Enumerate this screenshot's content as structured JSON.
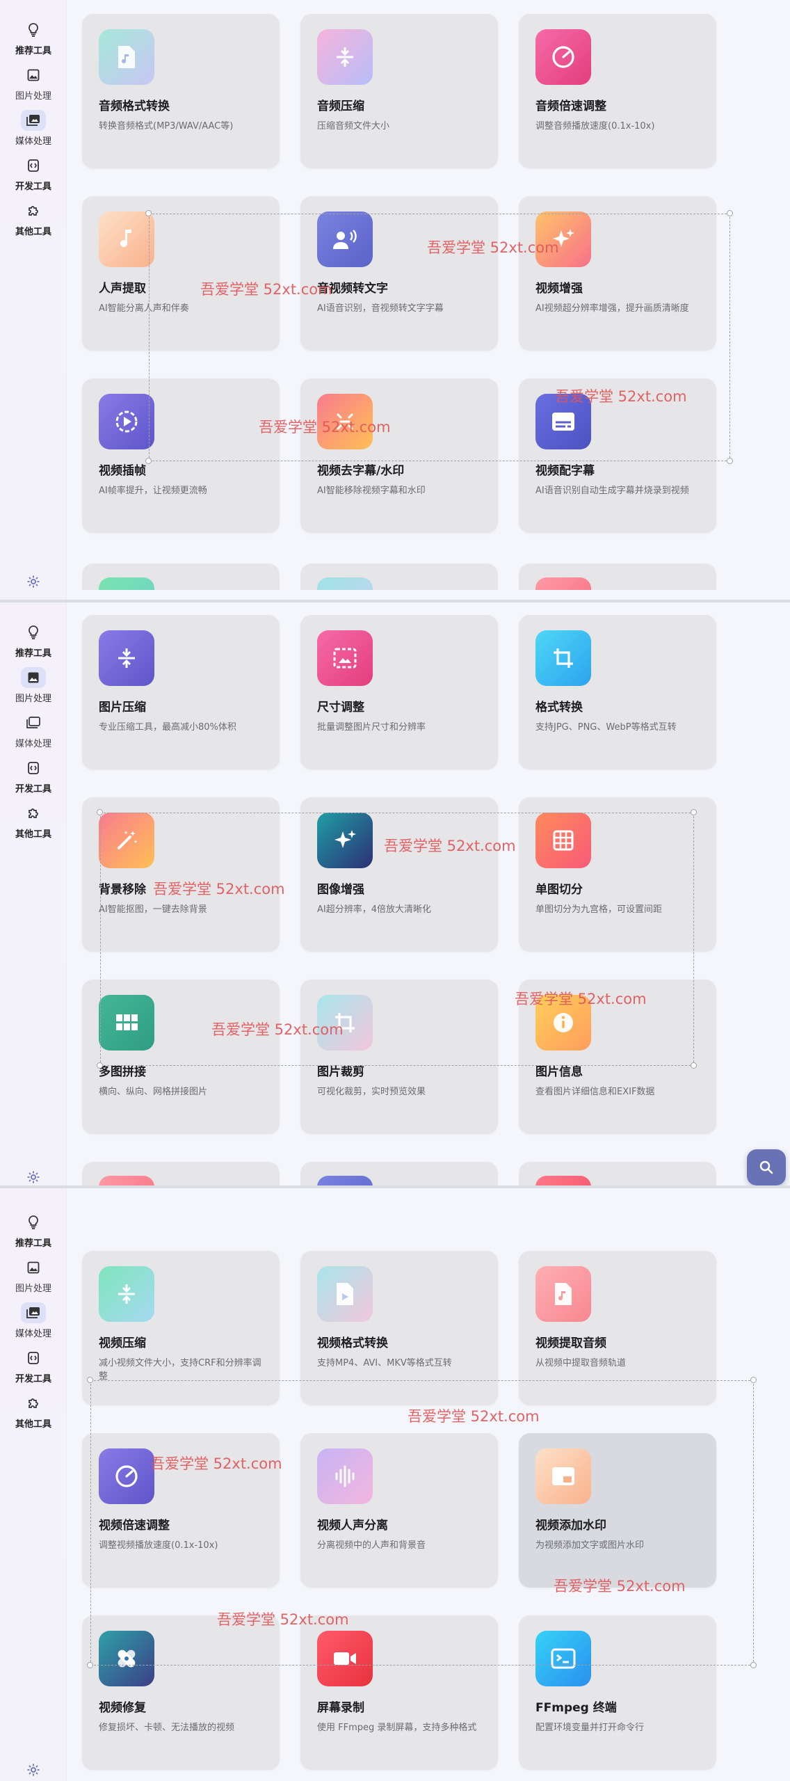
{
  "nav": {
    "recommend": "推荐工具",
    "image": "图片处理",
    "media": "媒体处理",
    "dev": "开发工具",
    "other": "其他工具"
  },
  "watermark": "吾爱学堂 52xt.com",
  "panel1": {
    "cards": [
      {
        "title": "音频格式转换",
        "desc": "转换音频格式(MP3/WAV/AAC等)",
        "icon": "audio-file-icon"
      },
      {
        "title": "音频压缩",
        "desc": "压缩音频文件大小",
        "icon": "compress-icon"
      },
      {
        "title": "音频倍速调整",
        "desc": "调整音频播放速度(0.1x-10x)",
        "icon": "speedometer-icon"
      },
      {
        "title": "人声提取",
        "desc": "AI智能分离人声和伴奏",
        "icon": "music-note-icon"
      },
      {
        "title": "音视频转文字",
        "desc": "AI语音识别，音视频转文字字幕",
        "icon": "voice-recognition-icon"
      },
      {
        "title": "视频增强",
        "desc": "AI视频超分辨率增强，提升画质清晰度",
        "icon": "sparkle-icon"
      },
      {
        "title": "视频插帧",
        "desc": "AI帧率提升，让视频更流畅",
        "icon": "play-circle-icon"
      },
      {
        "title": "视频去字幕/水印",
        "desc": "AI智能移除视频字幕和水印",
        "icon": "remove-watermark-icon"
      },
      {
        "title": "视频配字幕",
        "desc": "AI语音识别自动生成字幕并烧录到视频",
        "icon": "subtitles-icon"
      }
    ]
  },
  "panel2": {
    "cards": [
      {
        "title": "图片压缩",
        "desc": "专业压缩工具，最高减小80%体积",
        "icon": "compress-icon"
      },
      {
        "title": "尺寸调整",
        "desc": "批量调整图片尺寸和分辨率",
        "icon": "resize-image-icon"
      },
      {
        "title": "格式转换",
        "desc": "支持JPG、PNG、WebP等格式互转",
        "icon": "crop-icon"
      },
      {
        "title": "背景移除",
        "desc": "AI智能抠图，一键去除背景",
        "icon": "magic-wand-icon"
      },
      {
        "title": "图像增强",
        "desc": "AI超分辨率，4倍放大清晰化",
        "icon": "sparkle-icon"
      },
      {
        "title": "单图切分",
        "desc": "单图切分为九宫格，可设置间距",
        "icon": "grid-icon"
      },
      {
        "title": "多图拼接",
        "desc": "横向、纵向、网格拼接图片",
        "icon": "collage-icon"
      },
      {
        "title": "图片裁剪",
        "desc": "可视化裁剪，实时预览效果",
        "icon": "crop-icon"
      },
      {
        "title": "图片信息",
        "desc": "查看图片详细信息和EXIF数据",
        "icon": "info-icon"
      }
    ]
  },
  "panel3": {
    "cards": [
      {
        "title": "视频压缩",
        "desc": "减小视频文件大小，支持CRF和分辨率调整",
        "icon": "compress-icon"
      },
      {
        "title": "视频格式转换",
        "desc": "支持MP4、AVI、MKV等格式互转",
        "icon": "video-file-icon"
      },
      {
        "title": "视频提取音频",
        "desc": "从视频中提取音频轨道",
        "icon": "audio-file-icon"
      },
      {
        "title": "视频倍速调整",
        "desc": "调整视频播放速度(0.1x-10x)",
        "icon": "speedometer-icon"
      },
      {
        "title": "视频人声分离",
        "desc": "分离视频中的人声和背景音",
        "icon": "waveform-icon"
      },
      {
        "title": "视频添加水印",
        "desc": "为视频添加文字或图片水印",
        "icon": "picture-in-picture-icon"
      },
      {
        "title": "视频修复",
        "desc": "修复损坏、卡顿、无法播放的视频",
        "icon": "bandage-icon"
      },
      {
        "title": "屏幕录制",
        "desc": "使用 FFmpeg 录制屏幕，支持多种格式",
        "icon": "video-camera-icon"
      },
      {
        "title": "FFmpeg 终端",
        "desc": "配置环境变量并打开命令行",
        "icon": "terminal-icon"
      }
    ]
  },
  "colors": {
    "accent": "#6972b5",
    "watermark": "#e0575a",
    "card_bg": "#e6e6e8"
  }
}
